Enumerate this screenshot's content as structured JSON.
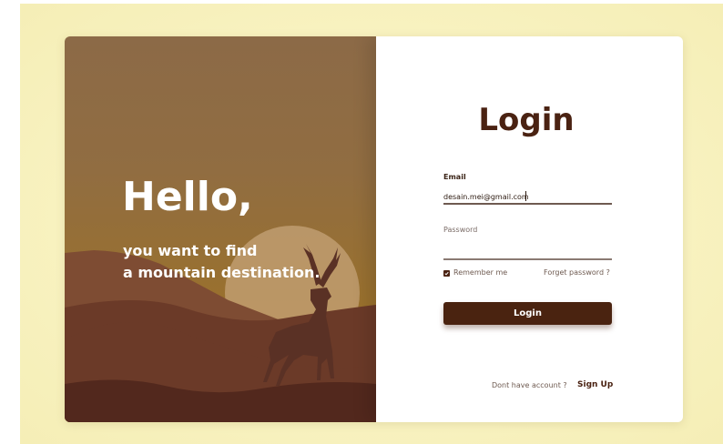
{
  "hero": {
    "greeting": "Hello,",
    "tagline_line1": "you want to find",
    "tagline_line2": "a mountain destination."
  },
  "login_form": {
    "title": "Login",
    "email_label": "Email",
    "email_value": "desain.mei@gmail.com",
    "password_label": "Password",
    "password_value": "",
    "remember_label": "Remember me",
    "remember_checked": true,
    "forget_password_label": "Forget password ?",
    "submit_label": "Login",
    "no_account_text": "Dont have account ?",
    "signup_label": "Sign Up"
  },
  "icons": {
    "scene": "mountain-landscape-with-deer-icon",
    "checkbox": "checkmark-icon"
  },
  "colors": {
    "page_background": "#f8f2c0",
    "hero_gradient_top": "#8c6a47",
    "hero_gradient_bottom": "#a07829",
    "accent_dark_brown": "#4a2310",
    "title_brown": "#4a2212",
    "form_background": "#ffffff"
  }
}
